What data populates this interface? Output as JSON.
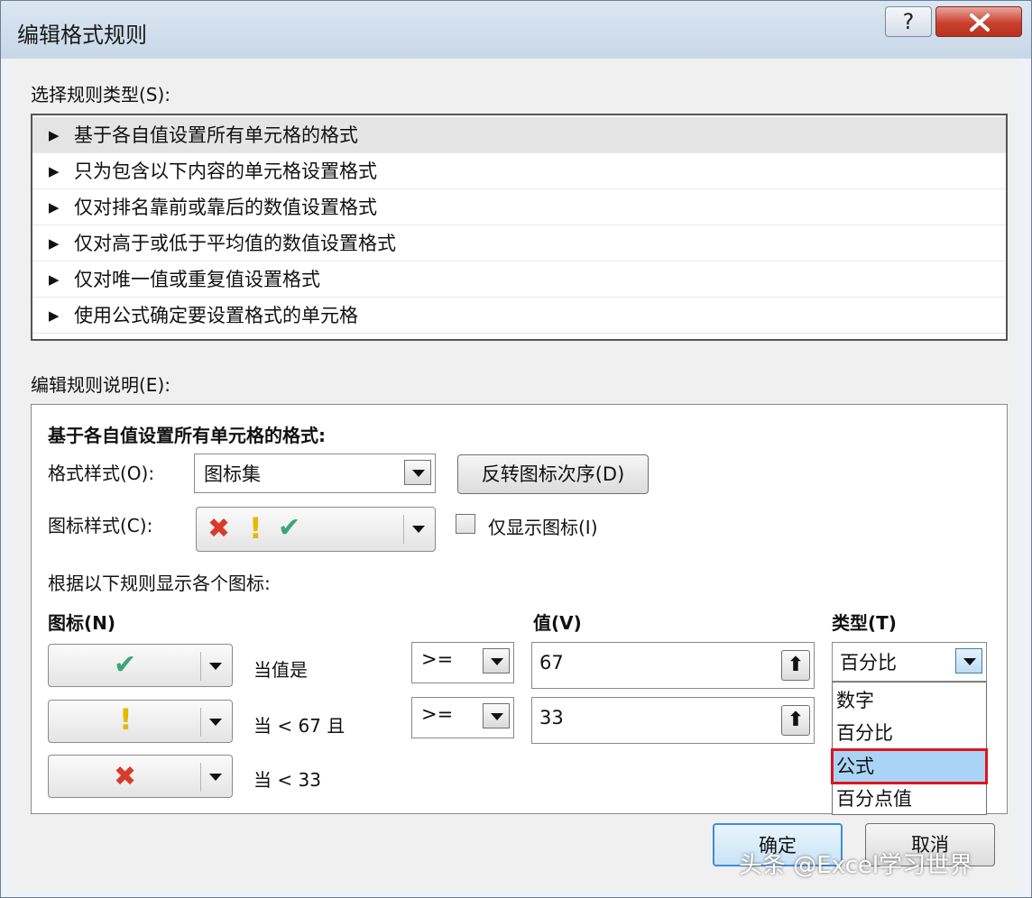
{
  "title": "编辑格式规则",
  "titlebar": {
    "help": "?",
    "close": "✕"
  },
  "rule_type_label": "选择规则类型(S):",
  "rule_types": [
    "基于各自值设置所有单元格的格式",
    "只为包含以下内容的单元格设置格式",
    "仅对排名靠前或靠后的数值设置格式",
    "仅对高于或低于平均值的数值设置格式",
    "仅对唯一值或重复值设置格式",
    "使用公式确定要设置格式的单元格"
  ],
  "edit_label": "编辑规则说明(E):",
  "panel": {
    "heading": "基于各自值设置所有单元格的格式:",
    "format_style_label": "格式样式(O):",
    "format_style_value": "图标集",
    "reverse_button": "反转图标次序(D)",
    "icon_style_label": "图标样式(C):",
    "show_icon_only": "仅显示图标(I)",
    "rule_caption": "根据以下规则显示各个图标:",
    "col_icon": "图标(N)",
    "col_value": "值(V)",
    "col_type": "类型(T)",
    "rows": [
      {
        "icon": "✔",
        "condition": "当值是",
        "operator": ">=",
        "value": "67"
      },
      {
        "icon": "!",
        "condition": "当 < 67 且",
        "operator": ">=",
        "value": "33"
      },
      {
        "icon": "✖",
        "condition": "当 < 33"
      }
    ],
    "type_selected": "百分比",
    "type_options": [
      "数字",
      "百分比",
      "公式",
      "百分点值"
    ]
  },
  "ok_button": "确定",
  "cancel_button": "取消",
  "watermark": "头条 @Excel学习世界"
}
